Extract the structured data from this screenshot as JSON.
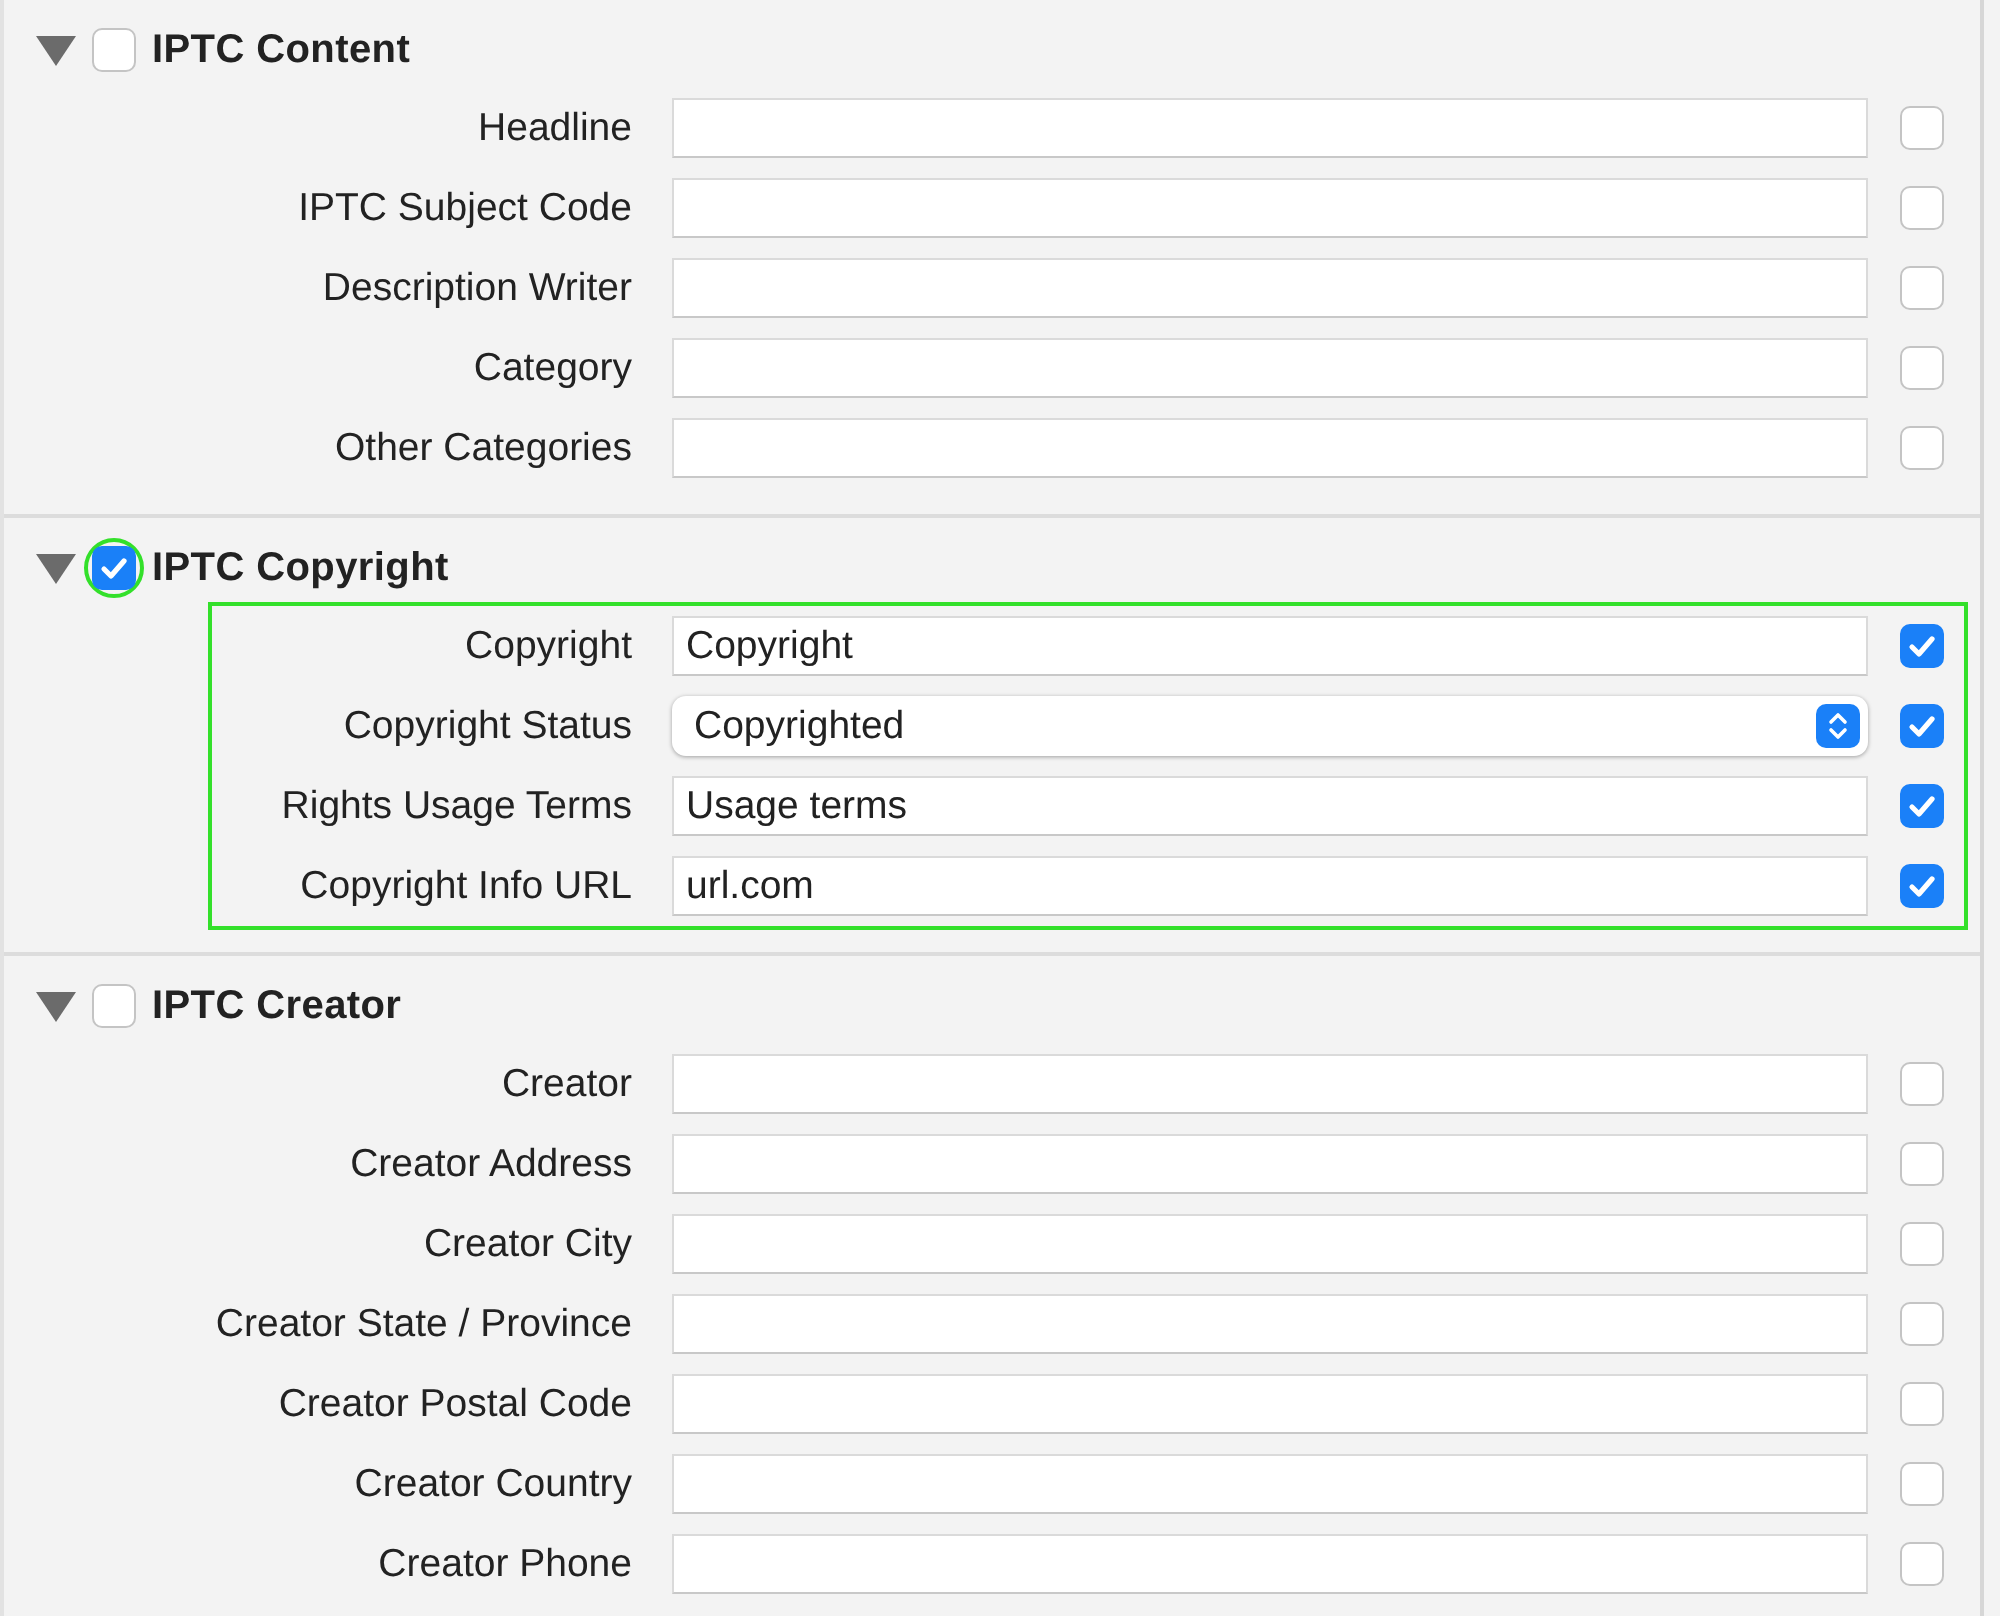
{
  "sections": [
    {
      "title": "IPTC Content",
      "expanded": true,
      "checked": false,
      "highlighted": false,
      "fields": [
        {
          "label": "Headline",
          "kind": "text",
          "checked": false
        },
        {
          "label": "IPTC Subject Code",
          "kind": "text",
          "checked": false
        },
        {
          "label": "Description Writer",
          "kind": "text",
          "checked": false
        },
        {
          "label": "Category",
          "kind": "text",
          "checked": false
        },
        {
          "label": "Other Categories",
          "kind": "text",
          "checked": false
        }
      ]
    },
    {
      "title": "IPTC Copyright",
      "expanded": true,
      "checked": true,
      "highlighted": true,
      "fields": [
        {
          "label": "Copyright",
          "kind": "text",
          "value": "Copyright",
          "checked": true
        },
        {
          "label": "Copyright Status",
          "kind": "popup",
          "value": "Copyrighted",
          "checked": true
        },
        {
          "label": "Rights Usage Terms",
          "kind": "text",
          "value": "Usage terms",
          "checked": true
        },
        {
          "label": "Copyright Info URL",
          "kind": "text",
          "value": "url.com",
          "checked": true
        }
      ]
    },
    {
      "title": "IPTC Creator",
      "expanded": true,
      "checked": false,
      "highlighted": false,
      "fields": [
        {
          "label": "Creator",
          "kind": "text",
          "checked": false
        },
        {
          "label": "Creator Address",
          "kind": "text",
          "checked": false
        },
        {
          "label": "Creator City",
          "kind": "text",
          "checked": false
        },
        {
          "label": "Creator State / Province",
          "kind": "text",
          "checked": false
        },
        {
          "label": "Creator Postal Code",
          "kind": "text",
          "checked": false
        },
        {
          "label": "Creator Country",
          "kind": "text",
          "checked": false
        },
        {
          "label": "Creator Phone",
          "kind": "text",
          "checked": false
        }
      ]
    }
  ]
}
